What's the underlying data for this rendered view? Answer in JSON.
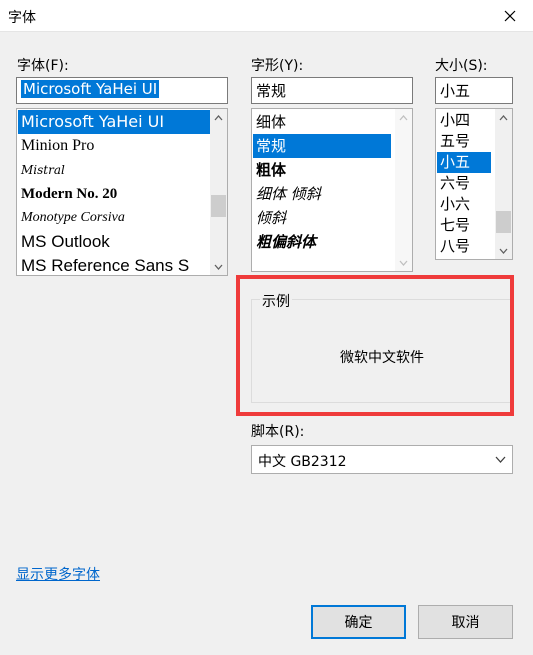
{
  "window": {
    "title": "字体"
  },
  "font": {
    "label": "字体(F):",
    "value": "Microsoft YaHei UI",
    "items": [
      {
        "label": "Microsoft YaHei UI",
        "selected": true
      },
      {
        "label": "Minion Pro"
      },
      {
        "label": "Mistral"
      },
      {
        "label": "Modern No. 20"
      },
      {
        "label": "Monotype Corsiva"
      },
      {
        "label": "MS Outlook"
      },
      {
        "label": "MS Reference Sans S"
      }
    ]
  },
  "style": {
    "label": "字形(Y):",
    "value": "常规",
    "items": [
      {
        "label": "细体"
      },
      {
        "label": "常规",
        "selected": true
      },
      {
        "label": "粗体"
      },
      {
        "label": "细体 倾斜"
      },
      {
        "label": "倾斜"
      },
      {
        "label": "粗偏斜体"
      }
    ]
  },
  "size": {
    "label": "大小(S):",
    "value": "小五",
    "items": [
      {
        "label": "小四"
      },
      {
        "label": "五号"
      },
      {
        "label": "小五",
        "selected": true
      },
      {
        "label": "六号"
      },
      {
        "label": "小六"
      },
      {
        "label": "七号"
      },
      {
        "label": "八号"
      }
    ]
  },
  "sample": {
    "label": "示例",
    "text": "微软中文软件"
  },
  "script": {
    "label": "脚本(R):",
    "value": "中文 GB2312"
  },
  "more_fonts_link": "显示更多字体",
  "buttons": {
    "ok": "确定",
    "cancel": "取消"
  },
  "colors": {
    "accent": "#0078d7",
    "highlight_frame": "#ef3b3b",
    "link": "#0066cc"
  }
}
